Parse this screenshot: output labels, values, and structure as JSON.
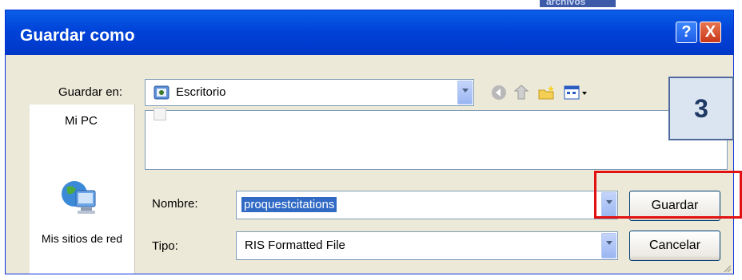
{
  "background": {
    "faded_text": "archivos"
  },
  "dialog": {
    "title": "Guardar como",
    "help_label": "?",
    "close_label": "X"
  },
  "save_in": {
    "label": "Guardar en:",
    "value": "Escritorio"
  },
  "places": {
    "my_pc": "Mi PC",
    "network": "Mis sitios de red"
  },
  "filename": {
    "label": "Nombre:",
    "value": "proquestcitations"
  },
  "filetype": {
    "label": "Tipo:",
    "value": "RIS Formatted File"
  },
  "buttons": {
    "save": "Guardar",
    "cancel": "Cancelar"
  },
  "annotation": {
    "step": "3",
    "step_color": "#1f3864",
    "highlight_color": "#e31212"
  },
  "colors": {
    "titlebar": "#0043d8",
    "dialog_bg": "#ece9d8",
    "selection": "#316ac5"
  }
}
